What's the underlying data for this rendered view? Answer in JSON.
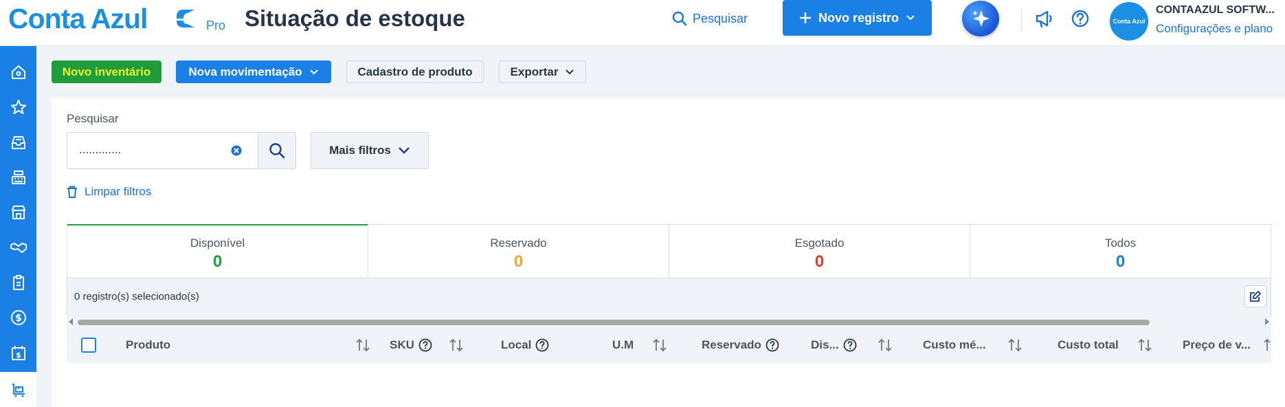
{
  "header": {
    "logo_text": "Conta Azul",
    "logo_badge": "Pro",
    "page_title": "Situação de estoque",
    "search_label": "Pesquisar",
    "new_record_label": "Novo registro",
    "avatar_text": "Conta Azul",
    "company_name": "CONTAAZUL SOFTW...",
    "settings_label": "Configurações e plano"
  },
  "sidebar": {
    "items": [
      {
        "icon": "home-icon"
      },
      {
        "icon": "star-icon"
      },
      {
        "icon": "inbox-icon"
      },
      {
        "icon": "cash-register-icon"
      },
      {
        "icon": "store-icon"
      },
      {
        "icon": "handshake-icon"
      },
      {
        "icon": "clipboard-icon"
      },
      {
        "icon": "dollar-icon"
      },
      {
        "icon": "calendar-dollar-icon"
      },
      {
        "icon": "inventory-icon",
        "active": true
      }
    ]
  },
  "actions": {
    "new_inventory": "Novo inventário",
    "new_movement": "Nova movimentação",
    "product_register": "Cadastro de produto",
    "export": "Exportar"
  },
  "filters": {
    "search_label": "Pesquisar",
    "search_value": ".............",
    "more_filters": "Mais filtros",
    "clear_filters": "Limpar filtros"
  },
  "tabs": [
    {
      "label": "Disponível",
      "count": "0",
      "color": "#1f9d3a"
    },
    {
      "label": "Reservado",
      "count": "0",
      "color": "#f5a623"
    },
    {
      "label": "Esgotado",
      "count": "0",
      "color": "#e8392b"
    },
    {
      "label": "Todos",
      "count": "0",
      "color": "#1a80e6"
    }
  ],
  "table": {
    "selected_text": "0 registro(s) selecionado(s)",
    "columns": [
      "Produto",
      "SKU",
      "Local",
      "U.M",
      "Reservado",
      "Dis...",
      "Custo mé...",
      "Custo total",
      "Preço de v..."
    ]
  },
  "colors": {
    "brand": "#1a8fe3",
    "primary": "#1a80e6",
    "green": "#1f9d3a"
  }
}
